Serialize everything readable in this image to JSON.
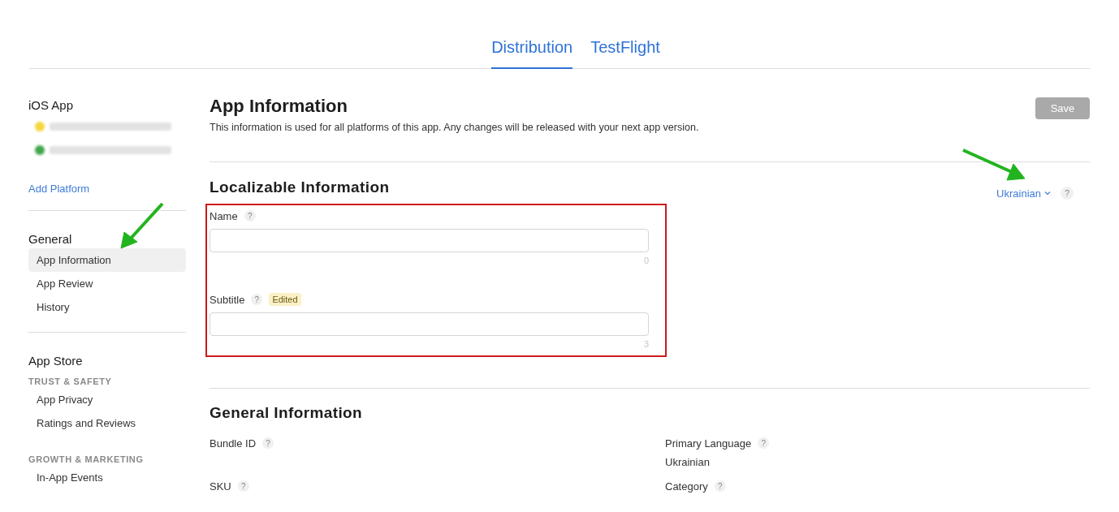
{
  "tabs": [
    {
      "label": "Distribution",
      "selected": true
    },
    {
      "label": "TestFlight",
      "selected": false
    }
  ],
  "sidebar": {
    "platform_title": "iOS App",
    "platform_versions": [
      {
        "color": "#f5d63c"
      },
      {
        "color": "#3fa64a"
      }
    ],
    "add_platform": "Add Platform",
    "sections": [
      {
        "title": "General",
        "groups": [
          {
            "items": [
              {
                "label": "App Information",
                "selected": true
              },
              {
                "label": "App Review",
                "selected": false
              },
              {
                "label": "History",
                "selected": false
              }
            ]
          }
        ]
      },
      {
        "title": "App Store",
        "groups": [
          {
            "heading": "TRUST & SAFETY",
            "items": [
              {
                "label": "App Privacy",
                "selected": false
              },
              {
                "label": "Ratings and Reviews",
                "selected": false
              }
            ]
          },
          {
            "heading": "GROWTH & MARKETING",
            "items": [
              {
                "label": "In-App Events",
                "selected": false
              }
            ]
          }
        ]
      }
    ]
  },
  "page": {
    "title": "App Information",
    "description": "This information is used for all platforms of this app. Any changes will be released with your next app version.",
    "save_button": {
      "label": "Save",
      "disabled": true
    }
  },
  "localizable": {
    "title": "Localizable Information",
    "language": "Ukrainian",
    "help": "?",
    "fields": [
      {
        "label": "Name",
        "help": "?",
        "counter": "0"
      },
      {
        "label": "Subtitle",
        "help": "?",
        "badge": "Edited",
        "counter": "3"
      }
    ]
  },
  "general": {
    "title": "General Information",
    "rows": [
      [
        {
          "label": "Bundle ID",
          "help": "?"
        },
        {
          "label": "Primary Language",
          "help": "?",
          "value": "Ukrainian"
        }
      ],
      [
        {
          "label": "SKU",
          "help": "?"
        },
        {
          "label": "Category",
          "help": "?"
        }
      ]
    ]
  }
}
